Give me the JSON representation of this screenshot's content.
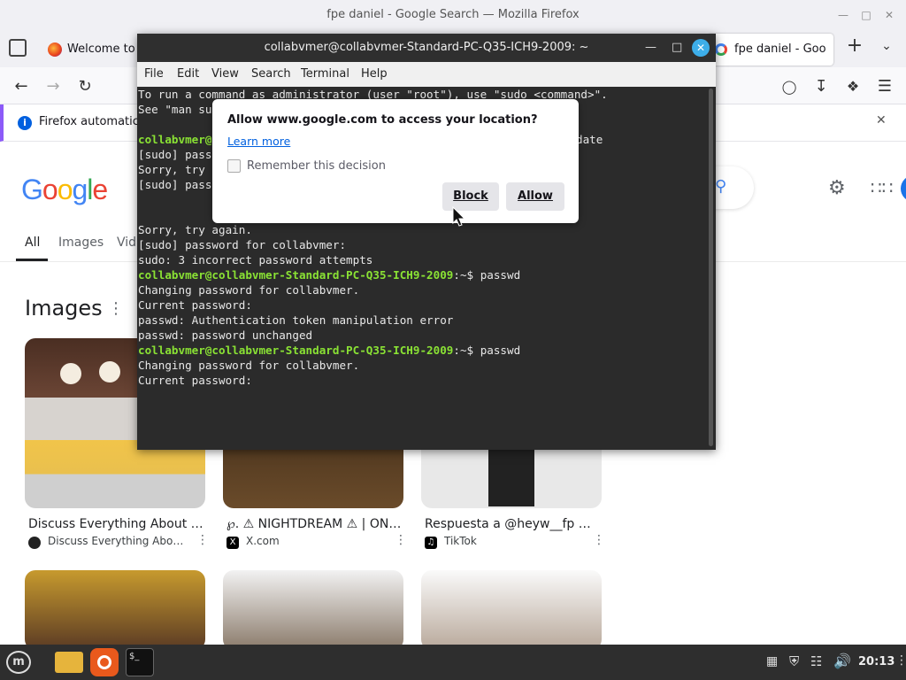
{
  "window": {
    "title": "fpe daniel - Google Search — Mozilla Firefox"
  },
  "tabs": [
    {
      "label": "Welcome to"
    },
    {
      "label": "fpe daniel - Goo"
    }
  ],
  "infobar": {
    "text": "Firefox automatica"
  },
  "google": {
    "logo": "Google",
    "tabs": [
      "All",
      "Images",
      "Vid"
    ],
    "images_heading": "Images",
    "results": [
      {
        "caption": "Discuss Everything About Fu...",
        "source": "Discuss Everything About ..."
      },
      {
        "caption": "℘. ⚠ NIGHTDREAM ⚠ | ONL...",
        "source": "X.com"
      },
      {
        "caption": "Respuesta a @heyw__fp wh...",
        "source": "TikTok"
      }
    ]
  },
  "terminal": {
    "title": "collabvmer@collabvmer-Standard-PC-Q35-ICH9-2009: ~",
    "menu": [
      "File",
      "Edit",
      "View",
      "Search",
      "Terminal",
      "Help"
    ],
    "lines": {
      "l1": "To run a command as administrator (user \"root\"), use \"sudo <command>\".",
      "l2": "See \"man su",
      "l3_prompt": "collabvmer@",
      "l3_rest": "date",
      "l4": "[sudo] pass",
      "l5": "Sorry, try",
      "l6": "[sudo] pass",
      "l7": "Sorry, try again.",
      "l8": "[sudo] password for collabvmer:",
      "l9": "sudo: 3 incorrect password attempts",
      "prompt": "collabvmer@collabvmer-Standard-PC-Q35-ICH9-2009",
      "cmd1": ":~$ passwd",
      "l11": "Changing password for collabvmer.",
      "l12": "Current password:",
      "l13": "passwd: Authentication token manipulation error",
      "l14": "passwd: password unchanged",
      "cmd2": ":~$ passwd",
      "l16": "Changing password for collabvmer.",
      "l17": "Current password:"
    }
  },
  "dialog": {
    "title": "Allow www.google.com to access your location?",
    "learn_more": "Learn more",
    "remember": "Remember this decision",
    "block": "Block",
    "allow": "Allow"
  },
  "taskbar": {
    "clock": "20:13"
  }
}
